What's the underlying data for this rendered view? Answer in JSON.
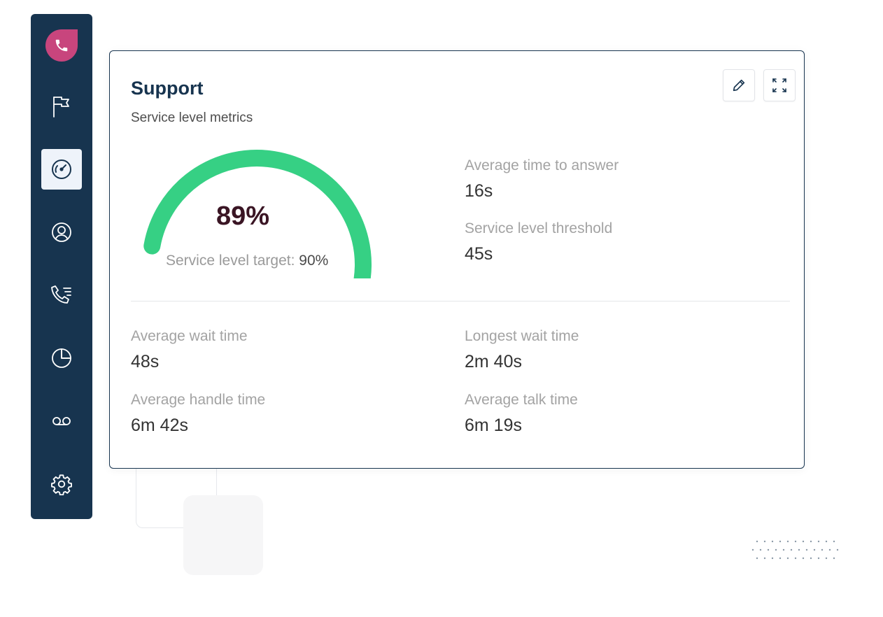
{
  "colors": {
    "sidebar_bg": "#17344f",
    "logo_bg": "#c8457d",
    "gauge_fill": "#36d084",
    "gauge_value_text": "#3a1524",
    "active_nav_bg": "#eef3fa"
  },
  "sidebar": {
    "logo_icon": "phone-icon",
    "items": [
      {
        "icon": "flag-icon",
        "active": false
      },
      {
        "icon": "dashboard-gauge-icon",
        "active": true
      },
      {
        "icon": "user-circle-icon",
        "active": false
      },
      {
        "icon": "call-list-icon",
        "active": false
      },
      {
        "icon": "pie-chart-icon",
        "active": false
      },
      {
        "icon": "voicemail-icon",
        "active": false
      },
      {
        "icon": "settings-gear-icon",
        "active": false
      }
    ]
  },
  "card": {
    "title": "Support",
    "subtitle": "Service level metrics",
    "toolbar": {
      "edit_icon": "pencil-icon",
      "expand_icon": "expand-icon"
    },
    "gauge": {
      "value_text": "89%",
      "value": 0.89,
      "target_label": "Service level target:",
      "target_value": "90%"
    },
    "top_metrics": [
      {
        "label": "Average time to answer",
        "value": "16s"
      },
      {
        "label": "Service level threshold",
        "value": "45s"
      }
    ],
    "bottom_metrics": [
      {
        "label": "Average wait time",
        "value": "48s"
      },
      {
        "label": "Longest wait time",
        "value": "2m 40s"
      },
      {
        "label": "Average handle time",
        "value": "6m 42s"
      },
      {
        "label": "Average talk time",
        "value": "6m 19s"
      }
    ]
  }
}
